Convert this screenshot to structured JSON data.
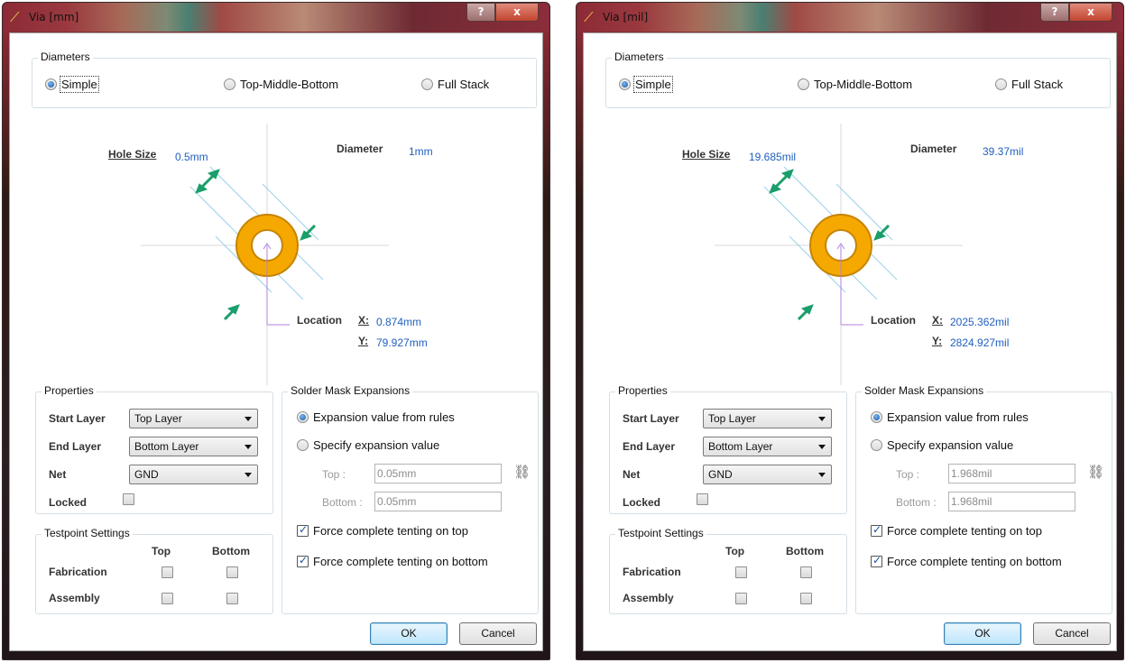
{
  "left": {
    "title": "Via [mm]",
    "hole_size_value": "0.5mm",
    "diameter_value": "1mm",
    "location_x": "0.874mm",
    "location_y": "79.927mm",
    "top_value": "0.05mm",
    "bottom_value": "0.05mm"
  },
  "right": {
    "title": "Via [mil]",
    "hole_size_value": "19.685mil",
    "diameter_value": "39.37mil",
    "location_x": "2025.362mil",
    "location_y": "2824.927mil",
    "top_value": "1.968mil",
    "bottom_value": "1.968mil"
  },
  "common": {
    "help_btn": "?",
    "close_btn": "x",
    "diameters_title": "Diameters",
    "radio_simple": "Simple",
    "radio_tmb": "Top-Middle-Bottom",
    "radio_full": "Full Stack",
    "hole_size_label": "Hole Size",
    "diameter_label": "Diameter",
    "location_label": "Location",
    "x_label": "X:",
    "y_label": "Y:",
    "properties_title": "Properties",
    "start_layer_label": "Start Layer",
    "start_layer_value": "Top Layer",
    "end_layer_label": "End Layer",
    "end_layer_value": "Bottom Layer",
    "net_label": "Net",
    "net_value": "GND",
    "locked_label": "Locked",
    "solder_title": "Solder Mask Expansions",
    "radio_rules": "Expansion value from rules",
    "radio_specify": "Specify expansion value",
    "top_label": "Top :",
    "bottom_label": "Bottom :",
    "tent_top": "Force complete tenting on top",
    "tent_bottom": "Force complete tenting on bottom",
    "testpoint_title": "Testpoint Settings",
    "tp_top_header": "Top",
    "tp_bottom_header": "Bottom",
    "fabrication_label": "Fabrication",
    "assembly_label": "Assembly",
    "ok": "OK",
    "cancel": "Cancel"
  },
  "icons": {
    "title_icon": "via-icon",
    "link": "chain-link-icon"
  },
  "colors": {
    "pad_ring": "#f5a800",
    "arrow": "#1a9e6a",
    "value_text": "#1f5fbf",
    "guide_line": "#9ad0e8",
    "origin_mark": "#b080e0"
  }
}
